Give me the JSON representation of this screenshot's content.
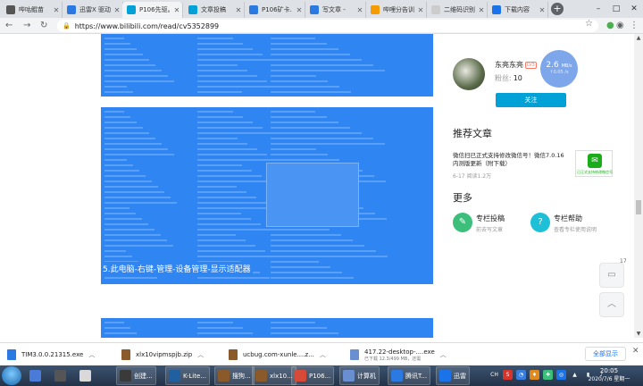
{
  "browser": {
    "tabs": [
      {
        "label": "哔咕鲲苗",
        "color": "#555555",
        "active": false
      },
      {
        "label": "迅雷X 驱动",
        "color": "#2a7ae2",
        "active": false
      },
      {
        "label": "P106先驱。",
        "color": "#00a1d6",
        "active": true
      },
      {
        "label": "文章投稿",
        "color": "#00a1d6",
        "active": false
      },
      {
        "label": "P106矿卡.",
        "color": "#2a7ae2",
        "active": false
      },
      {
        "label": "写文章 -",
        "color": "#2a7ae2",
        "active": false
      },
      {
        "label": "哔哩分告训",
        "color": "#f59b00",
        "active": false
      },
      {
        "label": "二维码识别",
        "color": "#cccccc",
        "active": false
      },
      {
        "label": "下载内容",
        "color": "#1a73e8",
        "active": false
      }
    ],
    "url": "https://www.bilibili.com/read/cv5352899"
  },
  "article": {
    "caption": "5.此电脑-右键-管理-设备管理-显示适配器"
  },
  "author": {
    "name": "东亮东亮",
    "level": "LV3",
    "fans_label": "粉丝:",
    "fans_value": "10",
    "follow_label": "关注",
    "speed_value": "2.6",
    "speed_unit": "MB/s",
    "speed_up": "↑0.05 /s"
  },
  "recommend": {
    "heading": "推荐文章",
    "title": "微信扫已正式支持修改微信号！微信7.0.16内测版更新（附下载）",
    "meta": "6-17 阅读1.2万",
    "qr_caption": "已正式支持修改微信号"
  },
  "more": {
    "heading": "更多",
    "items": [
      {
        "title": "专栏投稿",
        "sub": "前去写文章",
        "icon": "✎",
        "color": "#3bbf7a"
      },
      {
        "title": "专栏帮助",
        "sub": "查看专栏使用说明",
        "icon": "?",
        "color": "#1ec0d8"
      }
    ]
  },
  "side_buttons": {
    "comment_count": "17"
  },
  "downloads": {
    "items": [
      {
        "name": "TIM3.0.0.21315.exe",
        "sub": "",
        "color": "#2a7ae2"
      },
      {
        "name": "xlx10vipmspjb.zip",
        "sub": "",
        "color": "#8a5a2b"
      },
      {
        "name": "ucbug.com-xunle....z...",
        "sub": "",
        "color": "#8a5a2b"
      },
      {
        "name": "417.22-desktop-....exe",
        "sub": "已下载 12.3/499 MB，还需",
        "color": "#6a8fd0"
      }
    ],
    "show_all": "全部显示"
  },
  "taskbar": {
    "items": [
      {
        "label": "",
        "color": "#4a7bd8",
        "open": false
      },
      {
        "label": "",
        "color": "#555555",
        "open": false
      },
      {
        "label": "",
        "color": "#d9d9d9",
        "open": false
      },
      {
        "label": "创建...",
        "color": "#3a3a3a",
        "open": true
      },
      {
        "label": "K-Lite...",
        "color": "#2060a0",
        "open": true
      },
      {
        "label": "搜狗...",
        "color": "#8a5a2b",
        "open": true
      },
      {
        "label": "xlx10...",
        "color": "#8a5a2b",
        "open": true
      },
      {
        "label": "P106...",
        "color": "#d84a38",
        "open": true
      },
      {
        "label": "计算机",
        "color": "#6a8fd0",
        "open": true
      },
      {
        "label": "腾讯T...",
        "color": "#2a7ae2",
        "open": true
      },
      {
        "label": "迅雷",
        "color": "#1a73e8",
        "open": true
      }
    ],
    "tray": [
      "CH",
      "S",
      "◔",
      "♦",
      "✚",
      "◎",
      "▲",
      "▮",
      "♪"
    ],
    "time": "20:05",
    "date": "2020/7/6 星期一"
  },
  "colors": {
    "accent": "#00a1d6",
    "selection": "#2f86f2"
  }
}
